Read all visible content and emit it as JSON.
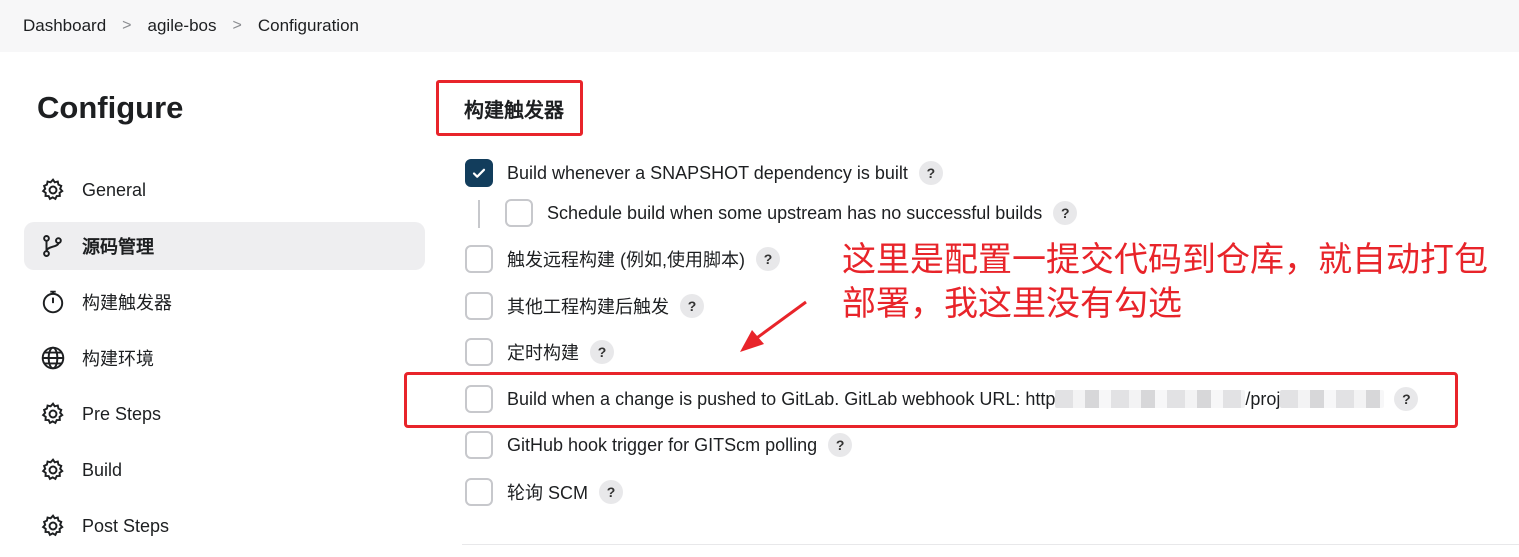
{
  "breadcrumb": {
    "items": [
      "Dashboard",
      "agile-bos",
      "Configuration"
    ],
    "separator": ">"
  },
  "page": {
    "title": "Configure"
  },
  "sidebar": {
    "items": [
      {
        "label": "General",
        "icon": "gear-icon",
        "active": false
      },
      {
        "label": "源码管理",
        "icon": "git-branch-icon",
        "active": true
      },
      {
        "label": "构建触发器",
        "icon": "timer-icon",
        "active": false
      },
      {
        "label": "构建环境",
        "icon": "globe-icon",
        "active": false
      },
      {
        "label": "Pre Steps",
        "icon": "gear-icon",
        "active": false
      },
      {
        "label": "Build",
        "icon": "gear-icon",
        "active": false
      },
      {
        "label": "Post Steps",
        "icon": "gear-icon",
        "active": false
      }
    ]
  },
  "section": {
    "title": "构建触发器",
    "options": [
      {
        "label": "Build whenever a SNAPSHOT dependency is built",
        "checked": true
      },
      {
        "label": "Schedule build when some upstream has no successful builds",
        "checked": false
      },
      {
        "label": "触发远程构建 (例如,使用脚本)",
        "checked": false
      },
      {
        "label": "其他工程构建后触发",
        "checked": false
      },
      {
        "label": "定时构建",
        "checked": false
      },
      {
        "label_prefix": "Build when a change is pushed to GitLab. GitLab webhook URL: http",
        "label_mid": "/proj",
        "checked": false
      },
      {
        "label": "GitHub hook trigger for GITScm polling",
        "checked": false
      },
      {
        "label": "轮询 SCM",
        "checked": false
      }
    ],
    "help_label": "?"
  },
  "annotation": {
    "text": "这里是配置一提交代码到仓库，就自动打包部署，我这里没有勾选",
    "color": "#e8242a"
  },
  "colors": {
    "checked": "#123d5c",
    "highlight": "#e8242a",
    "active_sidebar": "#eeeef0"
  }
}
